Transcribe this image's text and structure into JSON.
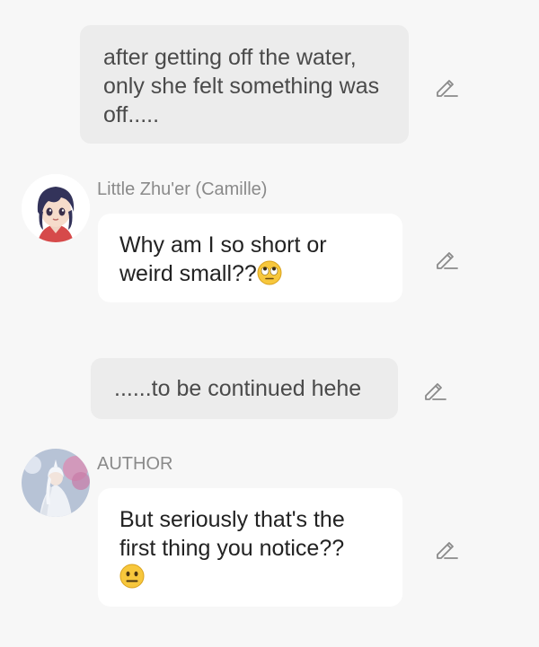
{
  "messages": {
    "m1": {
      "text": "after getting off the water, only she felt something was off....."
    },
    "m2": {
      "sender": "Little Zhu'er (Camille)",
      "text": "Why am I so short or weird small??",
      "emoji_icon": "eye-roll-emoji"
    },
    "m3": {
      "text": "......to be continued hehe"
    },
    "m4": {
      "sender": "AUTHOR",
      "text": "But seriously that's the first thing you notice??",
      "emoji_icon": "neutral-face-emoji"
    }
  },
  "icons": {
    "edit": "pencil-edit-icon"
  },
  "colors": {
    "background": "#f7f7f7",
    "narration_bubble": "#ececec",
    "chat_bubble": "#ffffff",
    "sender_name": "#8a8a8a"
  }
}
